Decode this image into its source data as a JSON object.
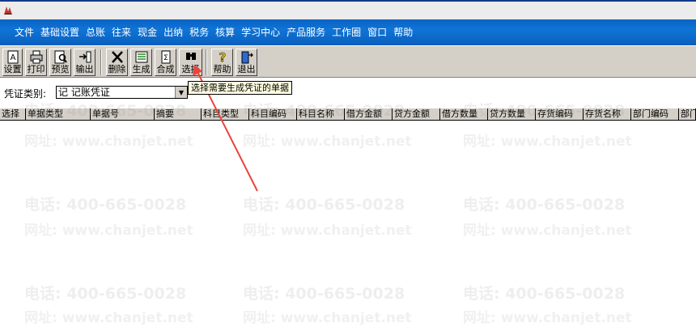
{
  "menu": [
    "文件",
    "基础设置",
    "总账",
    "往来",
    "现金",
    "出纳",
    "税务",
    "核算",
    "学习中心",
    "产品服务",
    "工作圈",
    "窗口",
    "帮助"
  ],
  "toolbar": {
    "setup": "设置",
    "print": "打印",
    "preview": "预览",
    "export": "输出",
    "delete": "删除",
    "generate": "生成",
    "merge": "合成",
    "select": "选择",
    "help": "帮助",
    "exit": "退出"
  },
  "filter": {
    "label": "凭证类别:",
    "value": "记 记账凭证"
  },
  "tooltip": "选择需要生成凭证的单据",
  "columns": [
    "选择",
    "单据类型",
    "单据号",
    "摘要",
    "科目类型",
    "科目编码",
    "科目名称",
    "借方金额",
    "贷方金额",
    "借方数量",
    "贷方数量",
    "存货编码",
    "存货名称",
    "部门编码",
    "部门"
  ],
  "watermark": {
    "phone": "电话: 400-665-0028",
    "site": "网址: www.chanjet.net"
  },
  "colors": {
    "menubar": "#0a63c4",
    "toolbar": "#d4d0c8",
    "arrow": "#e8453c"
  }
}
